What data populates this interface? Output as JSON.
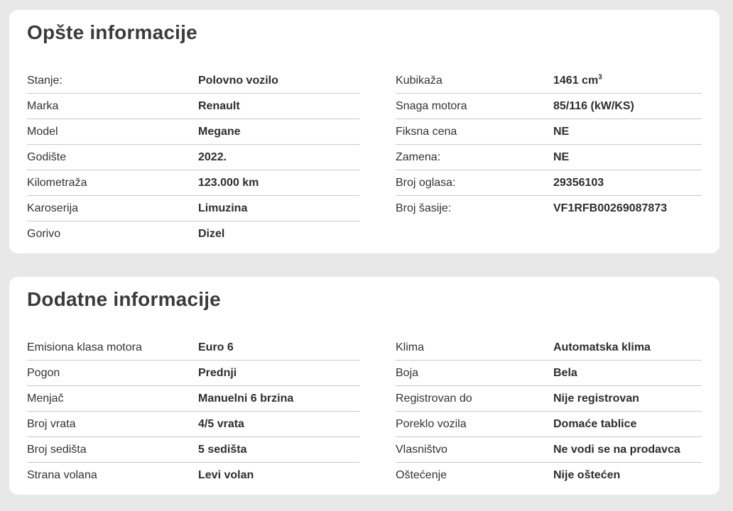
{
  "general": {
    "title": "Opšte informacije",
    "left": [
      {
        "label": "Stanje:",
        "value": "Polovno vozilo"
      },
      {
        "label": "Marka",
        "value": "Renault"
      },
      {
        "label": "Model",
        "value": "Megane"
      },
      {
        "label": "Godište",
        "value": "2022."
      },
      {
        "label": "Kilometraža",
        "value": "123.000 km"
      },
      {
        "label": "Karoserija",
        "value": "Limuzina"
      },
      {
        "label": "Gorivo",
        "value": "Dizel"
      }
    ],
    "right": [
      {
        "label": "Kubikaža",
        "value": "1461 cm",
        "unit_sup": "3"
      },
      {
        "label": "Snaga motora",
        "value": "85/116 (kW/KS)"
      },
      {
        "label": "Fiksna cena",
        "value": "NE"
      },
      {
        "label": "Zamena:",
        "value": "NE"
      },
      {
        "label": "Broj oglasa:",
        "value": "29356103"
      },
      {
        "label": "Broj šasije:",
        "value": "VF1RFB00269087873"
      }
    ]
  },
  "additional": {
    "title": "Dodatne informacije",
    "left": [
      {
        "label": "Emisiona klasa motora",
        "value": "Euro 6"
      },
      {
        "label": "Pogon",
        "value": "Prednji"
      },
      {
        "label": "Menjač",
        "value": "Manuelni 6 brzina"
      },
      {
        "label": "Broj vrata",
        "value": "4/5 vrata"
      },
      {
        "label": "Broj sedišta",
        "value": "5 sedišta"
      },
      {
        "label": "Strana volana",
        "value": "Levi volan"
      }
    ],
    "right": [
      {
        "label": "Klima",
        "value": "Automatska klima"
      },
      {
        "label": "Boja",
        "value": "Bela"
      },
      {
        "label": "Registrovan do",
        "value": "Nije registrovan"
      },
      {
        "label": "Poreklo vozila",
        "value": "Domaće tablice"
      },
      {
        "label": "Vlasništvo",
        "value": "Ne vodi se na prodavca"
      },
      {
        "label": "Oštećenje",
        "value": "Nije oštećen"
      }
    ]
  }
}
